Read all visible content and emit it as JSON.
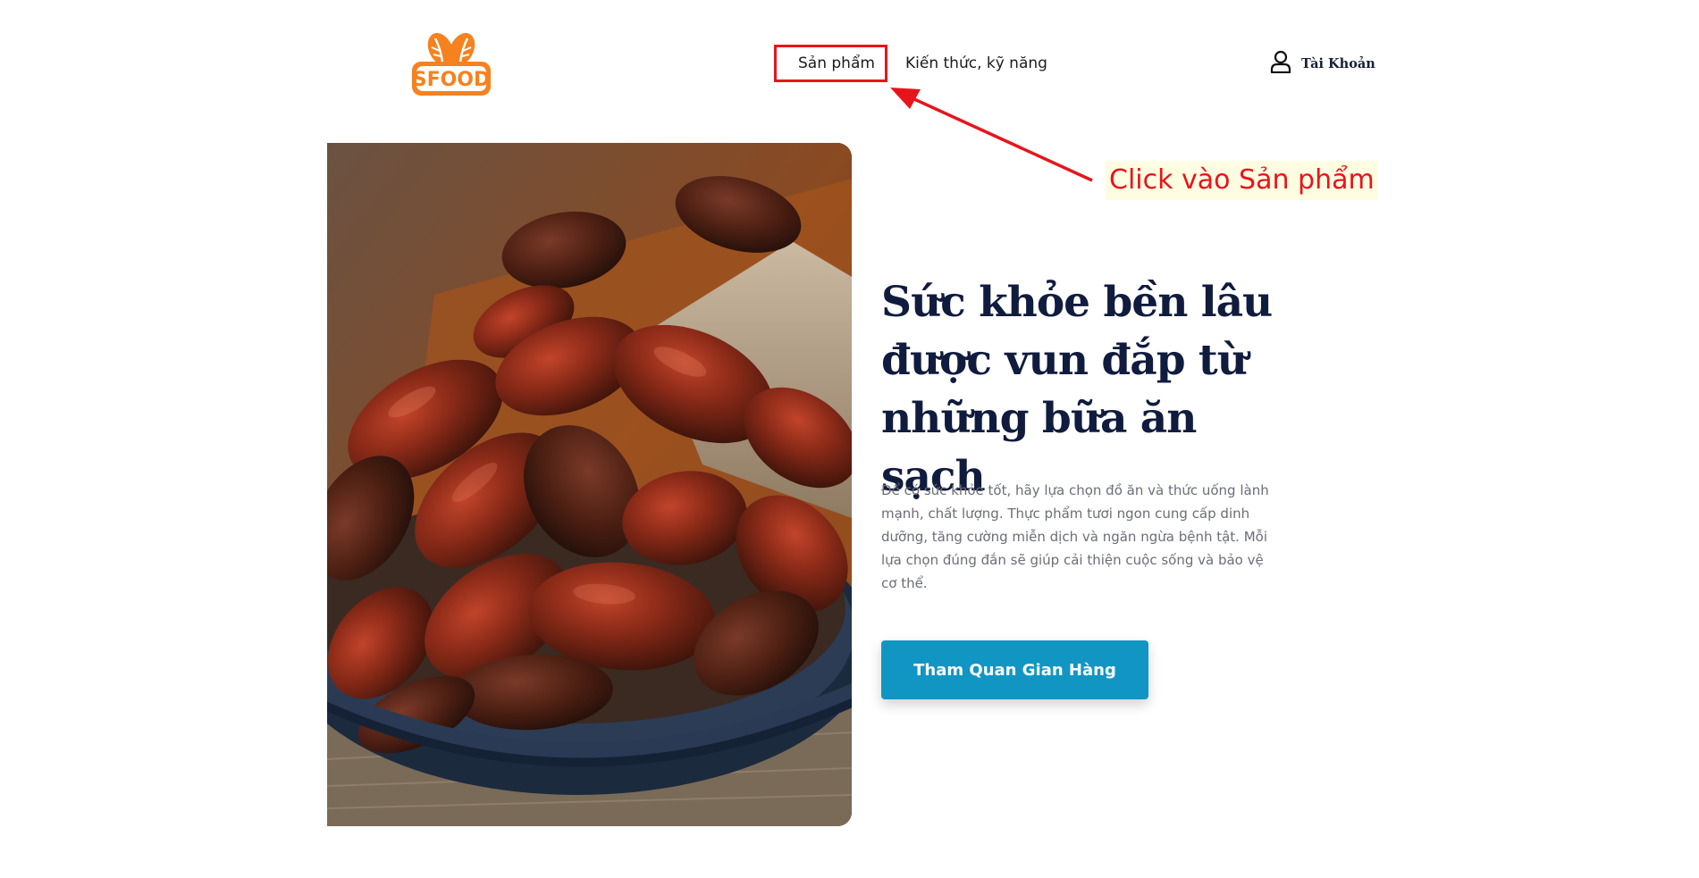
{
  "header": {
    "logo_text": "SFOOD",
    "nav": {
      "products_label": "Sản phẩm",
      "knowledge_label": "Kiến thức, kỹ năng"
    },
    "account_label": "Tài Khoản"
  },
  "annotation": {
    "text": "Click vào Sản phẩm",
    "color": "#e8141c"
  },
  "hero": {
    "title": "Sức khỏe bền lâu được vun đắp từ những bữa ăn sạch",
    "description": "Để có sức khỏe tốt, hãy lựa chọn đồ ăn và thức uống lành mạnh, chất lượng. Thực phẩm tươi ngon cung cấp dinh dưỡng, tăng cường miễn dịch và ngăn ngừa bệnh tật. Mỗi lựa chọn đúng đắn sẽ giúp cải thiện cuộc sống và bảo vệ cơ thể.",
    "cta_label": "Tham Quan Gian Hàng",
    "image_subject": "bowl of dried dates"
  },
  "colors": {
    "logo_orange": "#f5821f",
    "title_navy": "#101c3e",
    "cta_blue": "#1196c4",
    "annotation_red": "#e8141c"
  }
}
